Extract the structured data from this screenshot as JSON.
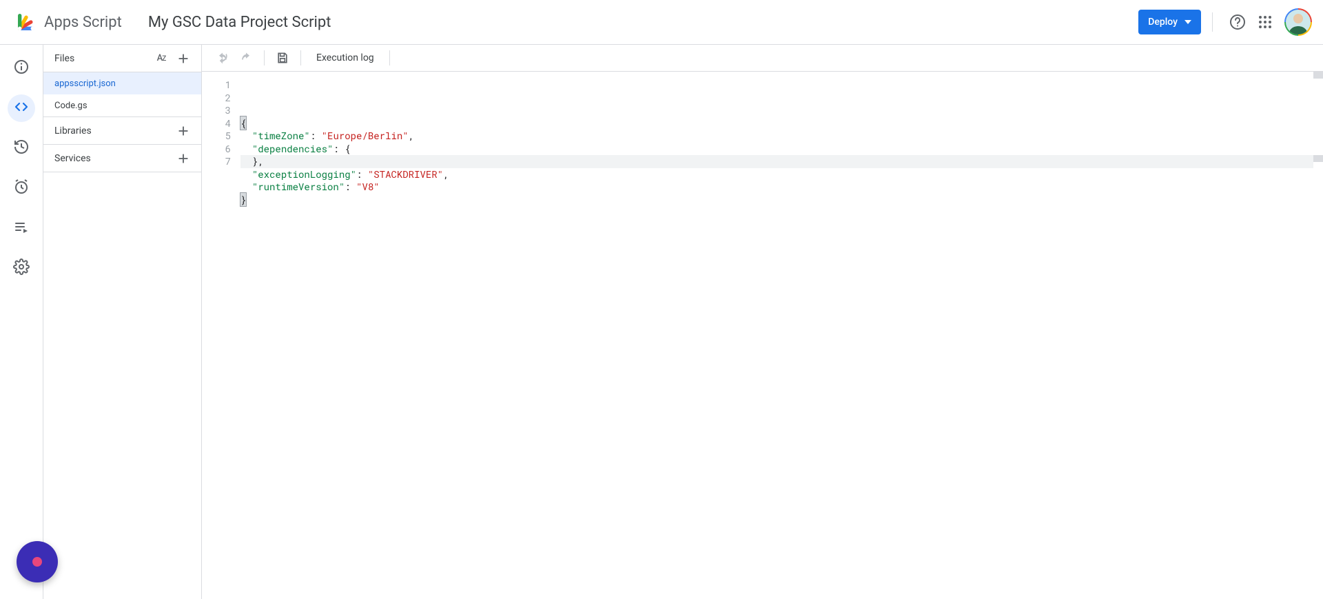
{
  "header": {
    "product_name": "Apps Script",
    "project_title": "My GSC Data Project Script",
    "deploy_label": "Deploy"
  },
  "rail": {
    "items": [
      {
        "name": "overview",
        "icon": "info"
      },
      {
        "name": "editor",
        "icon": "code",
        "active": true
      },
      {
        "name": "history",
        "icon": "history"
      },
      {
        "name": "triggers",
        "icon": "alarm"
      },
      {
        "name": "executions",
        "icon": "playlist"
      },
      {
        "name": "settings",
        "icon": "gear"
      }
    ]
  },
  "sidebar": {
    "files_label": "Files",
    "files": [
      {
        "name": "appsscript.json",
        "active": true
      },
      {
        "name": "Code.gs",
        "active": false
      }
    ],
    "libraries_label": "Libraries",
    "services_label": "Services"
  },
  "toolbar": {
    "execution_log_label": "Execution log"
  },
  "editor": {
    "line_numbers": [
      "1",
      "2",
      "3",
      "4",
      "5",
      "6",
      "7"
    ],
    "current_line_index": 6,
    "file_content_raw": "{\n  \"timeZone\": \"Europe/Berlin\",\n  \"dependencies\": {\n  },\n  \"exceptionLogging\": \"STACKDRIVER\",\n  \"runtimeVersion\": \"V8\"\n}",
    "tokens": [
      [
        {
          "t": "{",
          "c": "punc",
          "bracket": true
        }
      ],
      [
        {
          "t": "  ",
          "c": "plain"
        },
        {
          "t": "\"timeZone\"",
          "c": "key"
        },
        {
          "t": ": ",
          "c": "punc"
        },
        {
          "t": "\"Europe/Berlin\"",
          "c": "str"
        },
        {
          "t": ",",
          "c": "punc"
        }
      ],
      [
        {
          "t": "  ",
          "c": "plain"
        },
        {
          "t": "\"dependencies\"",
          "c": "key"
        },
        {
          "t": ": ",
          "c": "punc"
        },
        {
          "t": "{",
          "c": "punc"
        }
      ],
      [
        {
          "t": "  ",
          "c": "plain"
        },
        {
          "t": "}",
          "c": "punc"
        },
        {
          "t": ",",
          "c": "punc"
        }
      ],
      [
        {
          "t": "  ",
          "c": "plain"
        },
        {
          "t": "\"exceptionLogging\"",
          "c": "key"
        },
        {
          "t": ": ",
          "c": "punc"
        },
        {
          "t": "\"STACKDRIVER\"",
          "c": "str"
        },
        {
          "t": ",",
          "c": "punc"
        }
      ],
      [
        {
          "t": "  ",
          "c": "plain"
        },
        {
          "t": "\"runtimeVersion\"",
          "c": "key"
        },
        {
          "t": ": ",
          "c": "punc"
        },
        {
          "t": "\"V8\"",
          "c": "str"
        }
      ],
      [
        {
          "t": "}",
          "c": "punc",
          "bracket": true,
          "cursor_after": true
        }
      ]
    ]
  }
}
